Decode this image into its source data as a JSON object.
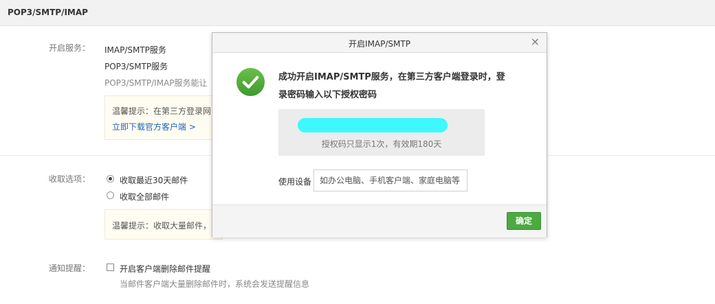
{
  "section": {
    "title": "POP3/SMTP/IMAP"
  },
  "services": {
    "label": "开启服务：",
    "items": [
      "IMAP/SMTP服务",
      "POP3/SMTP服务"
    ],
    "note": "POP3/SMTP/IMAP服务能让",
    "tip": "温馨提示：在第三方登录网",
    "download_link": "立即下载官方客户端 >"
  },
  "receive": {
    "label": "收取选项：",
    "options": [
      {
        "label": "收取最近30天邮件",
        "checked": true
      },
      {
        "label": "收取全部邮件",
        "checked": false
      }
    ],
    "tip": "温馨提示：收取大量邮件，"
  },
  "notify": {
    "label": "通知提醒：",
    "checkbox_label": "开启客户端删除邮件提醒",
    "description": "当邮件客户端大量删除邮件时，系统会发送提醒信息"
  },
  "modal": {
    "title": "开启IMAP/SMTP",
    "close": "×",
    "message": "成功开启IMAP/SMTP服务，在第三方客户端登录时，登录密码输入以下授权密码",
    "code_note": "授权码只显示1次，有效期180天",
    "device_label": "使用设备",
    "device_placeholder": "如办公电脑、手机客户端、家庭电脑等",
    "ok_button": "确定"
  },
  "colors": {
    "accent": "#4da941",
    "link": "#1f63b6",
    "redaction": "#3ef8ff"
  }
}
